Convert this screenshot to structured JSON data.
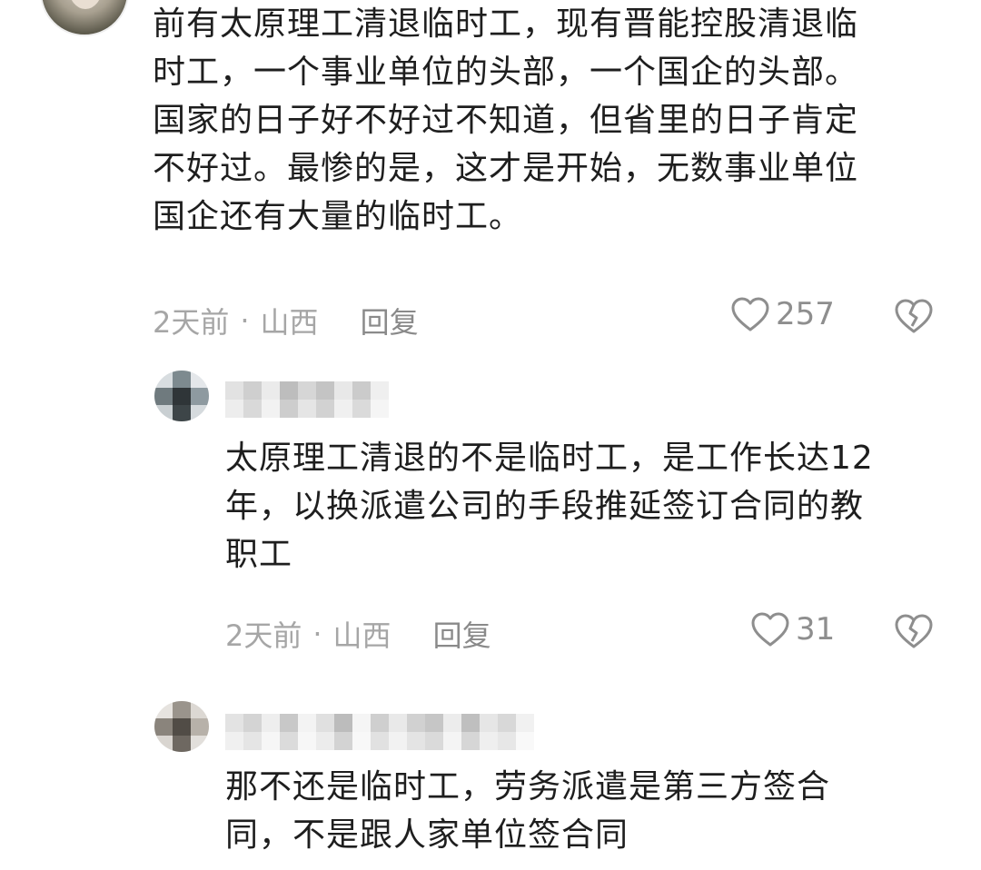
{
  "comment_main": {
    "text": "前有太原理工清退临时工，现有晋能控股清退临\n时工，一个事业单位的头部，一个国企的头部。\n国家的日子好不好过不知道，但省里的日子肯定\n不好过。最惨的是，这才是开始，无数事业单位\n国企还有大量的临时工。",
    "time": "2天前",
    "separator": "·",
    "location": "山西",
    "reply_label": "回复",
    "likes": "257"
  },
  "reply_1": {
    "text": "太原理工清退的不是临时工，是工作长达12\n年，以换派遣公司的手段推延签订合同的教\n职工",
    "time": "2天前",
    "separator": "·",
    "location": "山西",
    "reply_label": "回复",
    "likes": "31"
  },
  "reply_2": {
    "text": "那不还是临时工，劳务派遣是第三方签合\n同，不是跟人家单位签合同"
  },
  "colors": {
    "text": "#1e1e1e",
    "meta": "#a6a6a6",
    "icon": "#8e8e8e"
  },
  "icons": {
    "like": "heart-outline-icon",
    "dislike": "broken-heart-icon"
  }
}
